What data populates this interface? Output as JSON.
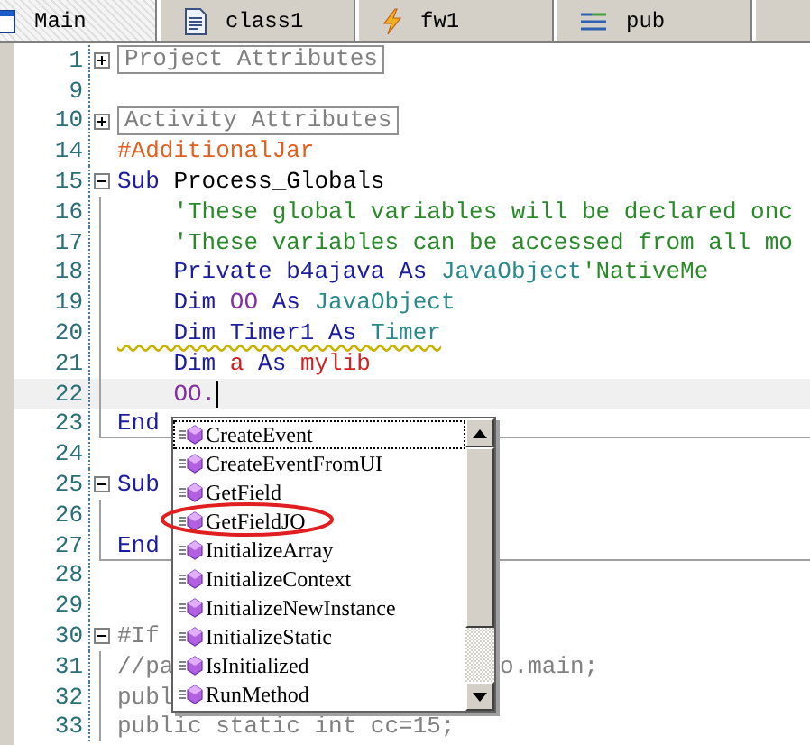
{
  "tabs": [
    {
      "label": "Main",
      "selected": true
    },
    {
      "label": "class1",
      "selected": false
    },
    {
      "label": "fw1",
      "selected": false
    },
    {
      "label": "pub",
      "selected": false
    }
  ],
  "lines": [
    {
      "num": "1",
      "kind": "collapsed",
      "folded": "Project Attributes"
    },
    {
      "num": "9",
      "kind": "plain"
    },
    {
      "num": "10",
      "kind": "collapsed",
      "folded": "Activity Attributes"
    },
    {
      "num": "14",
      "kind": "plain",
      "tokens": [
        {
          "text": "#AdditionalJar",
          "kind": "directive"
        }
      ]
    },
    {
      "num": "15",
      "kind": "start",
      "tokens": [
        {
          "text": "Sub",
          "kind": "keyword"
        },
        {
          "text": " Process_Globals",
          "kind": "plain"
        }
      ]
    },
    {
      "num": "16",
      "kind": "body",
      "tokens": [
        {
          "text": "    'These global variables will be declared onc",
          "kind": "comment"
        }
      ]
    },
    {
      "num": "17",
      "kind": "body",
      "tokens": [
        {
          "text": "    'These variables can be accessed from all mo",
          "kind": "comment"
        }
      ]
    },
    {
      "num": "18",
      "kind": "body",
      "tokens": [
        {
          "text": "    Private b4ajava As ",
          "kind": "keyword"
        },
        {
          "text": "JavaObject",
          "kind": "type"
        },
        {
          "text": "'NativeMe",
          "kind": "comment"
        }
      ]
    },
    {
      "num": "19",
      "kind": "body",
      "tokens": [
        {
          "text": "    Dim ",
          "kind": "keyword"
        },
        {
          "text": "OO",
          "kind": "object"
        },
        {
          "text": " As ",
          "kind": "keyword"
        },
        {
          "text": "JavaObject",
          "kind": "type"
        }
      ]
    },
    {
      "num": "20",
      "kind": "body",
      "warning": true,
      "tokens": [
        {
          "text": "    Dim Timer1 As ",
          "kind": "keyword"
        },
        {
          "text": "Timer",
          "kind": "type"
        }
      ]
    },
    {
      "num": "21",
      "kind": "body",
      "tokens": [
        {
          "text": "    Dim ",
          "kind": "keyword"
        },
        {
          "text": "a",
          "kind": "library"
        },
        {
          "text": " As ",
          "kind": "keyword"
        },
        {
          "text": "mylib",
          "kind": "library"
        }
      ]
    },
    {
      "num": "22",
      "kind": "body",
      "current": true,
      "tokens": [
        {
          "text": "    OO.",
          "kind": "object"
        }
      ]
    },
    {
      "num": "23",
      "kind": "end",
      "tokens": [
        {
          "text": "End",
          "kind": "keyword"
        }
      ]
    },
    {
      "num": "24",
      "kind": "plain"
    },
    {
      "num": "25",
      "kind": "start",
      "tokens": [
        {
          "text": "Sub",
          "kind": "keyword"
        }
      ]
    },
    {
      "num": "26",
      "kind": "body"
    },
    {
      "num": "27",
      "kind": "end",
      "tokens": [
        {
          "text": "End",
          "kind": "keyword"
        }
      ]
    },
    {
      "num": "28",
      "kind": "plain"
    },
    {
      "num": "29",
      "kind": "plain"
    },
    {
      "num": "30",
      "kind": "start",
      "tokens": [
        {
          "text": "#If",
          "kind": "java"
        }
      ]
    },
    {
      "num": "31",
      "kind": "body",
      "tokens": [
        {
          "text": "//pa",
          "kind": "java"
        }
      ],
      "tail": "o.main;"
    },
    {
      "num": "32",
      "kind": "body",
      "tokens": [
        {
          "text": "publ",
          "kind": "java"
        }
      ]
    },
    {
      "num": "33",
      "kind": "body",
      "tokens": [
        {
          "text": "public static int cc=15;",
          "kind": "java"
        }
      ]
    }
  ],
  "completion": {
    "items": [
      {
        "label": "CreateEvent",
        "selected": true
      },
      {
        "label": "CreateEventFromUI",
        "selected": false
      },
      {
        "label": "GetField",
        "selected": false
      },
      {
        "label": "GetFieldJO",
        "selected": false,
        "circled": true
      },
      {
        "label": "InitializeArray",
        "selected": false
      },
      {
        "label": "InitializeContext",
        "selected": false
      },
      {
        "label": "InitializeNewInstance",
        "selected": false
      },
      {
        "label": "InitializeStatic",
        "selected": false
      },
      {
        "label": "IsInitialized",
        "selected": false
      },
      {
        "label": "RunMethod",
        "selected": false
      }
    ]
  }
}
